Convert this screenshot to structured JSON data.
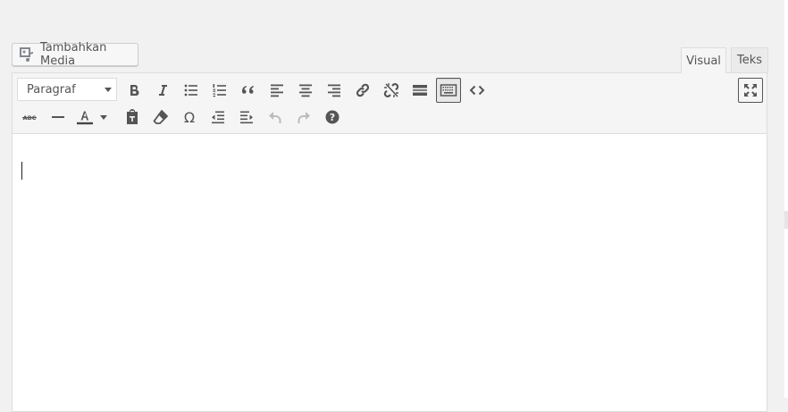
{
  "media_button": {
    "label": "Tambahkan Media",
    "icon": "add-media-icon"
  },
  "tabs": {
    "visual": "Visual",
    "text": "Teks",
    "active": "visual"
  },
  "toolbar": {
    "format_select": {
      "value": "Paragraf"
    },
    "row1": [
      "bold",
      "italic",
      "bulleted-list",
      "numbered-list",
      "blockquote",
      "align-left",
      "align-center",
      "align-right",
      "insert-link",
      "remove-link",
      "read-more",
      "toolbar-toggle",
      "code"
    ],
    "row2": [
      "strikethrough",
      "horizontal-line",
      "text-color",
      "paste-as-text",
      "clear-formatting",
      "special-character",
      "decrease-indent",
      "increase-indent",
      "undo",
      "redo",
      "keyboard-shortcuts"
    ],
    "fullscreen": "fullscreen",
    "active_button": "toolbar-toggle",
    "disabled_buttons": [
      "undo",
      "redo"
    ]
  },
  "colors": {
    "text_color_underline": "#444444",
    "accent": "#555555"
  }
}
